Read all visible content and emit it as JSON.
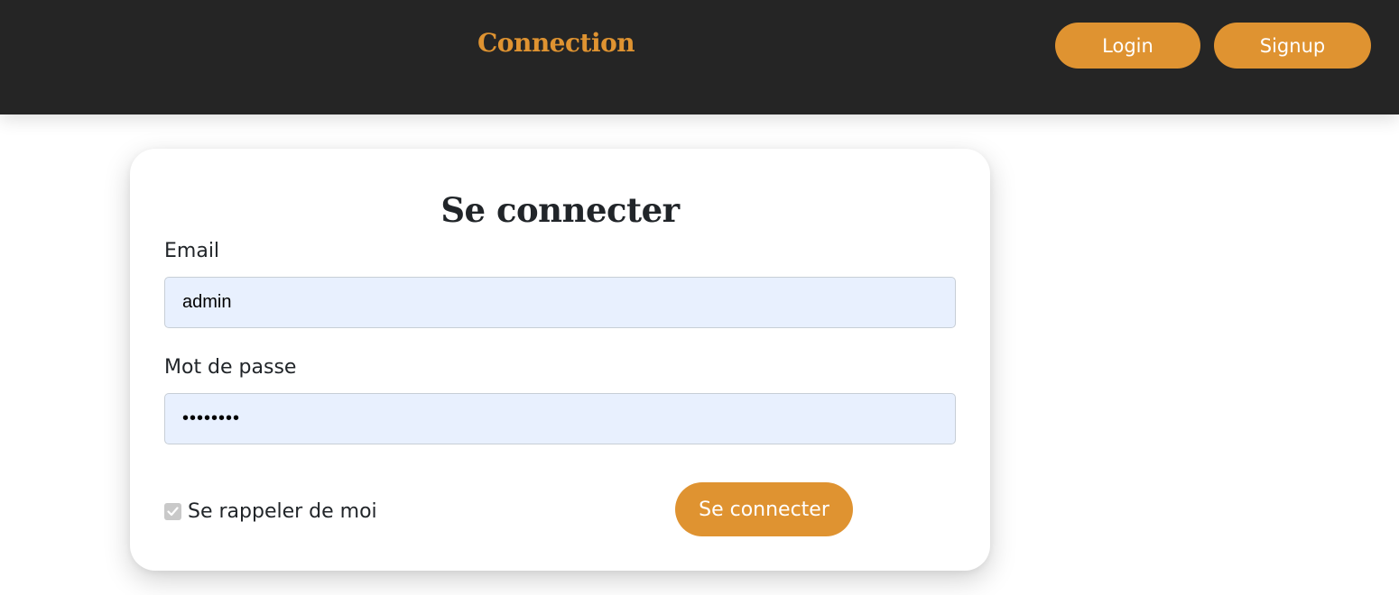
{
  "navbar": {
    "brand": "Connection",
    "login_label": "Login",
    "signup_label": "Signup"
  },
  "form": {
    "title": "Se connecter",
    "email_label": "Email",
    "email_value": "admin",
    "password_label": "Mot de passe",
    "password_value": "********",
    "remember_label": "Se rappeler de moi",
    "remember_checked": true,
    "submit_label": "Se connecter"
  },
  "colors": {
    "navbar_bg": "#252525",
    "accent": "#df9331",
    "input_bg": "#e8f0fe"
  },
  "icons": {
    "checkbox": "check-icon"
  }
}
